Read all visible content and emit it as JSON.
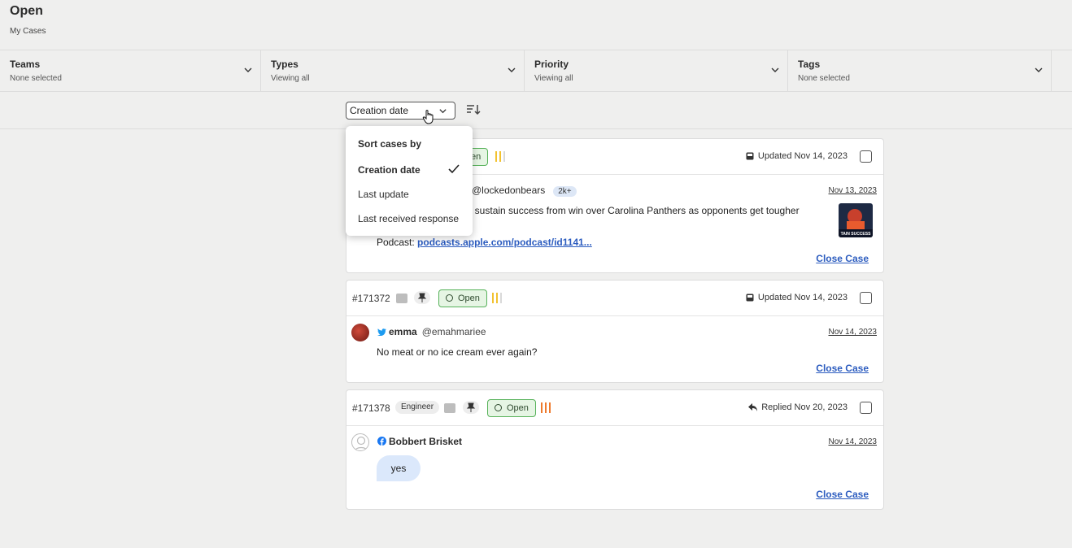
{
  "header": {
    "title": "Open",
    "subtitle": "My Cases"
  },
  "filters": [
    {
      "label": "Teams",
      "value": "None selected"
    },
    {
      "label": "Types",
      "value": "Viewing all"
    },
    {
      "label": "Priority",
      "value": "Viewing all"
    },
    {
      "label": "Tags",
      "value": "None selected"
    }
  ],
  "sort": {
    "selected": "Creation date",
    "menu_title": "Sort cases by",
    "options": [
      "Creation date",
      "Last update",
      "Last received response"
    ]
  },
  "cases": [
    {
      "status": "Open",
      "status_partial": "en",
      "updated": "Updated Nov 14, 2023",
      "handle": "@lockedonbears",
      "followers_badge": "2k+",
      "date": "Nov 13, 2023",
      "text": "an sustain success from win over Carolina Panthers as opponents get tougher",
      "podcast_label": "Podcast:",
      "podcast_link": "podcasts.apple.com/podcast/id1141...",
      "thumb_caption": "TAIN SUCCESS",
      "close_label": "Close Case",
      "priority_colors": [
        "#f2c230",
        "#f2c230",
        "#d9d9d9"
      ]
    },
    {
      "id": "#171372",
      "status": "Open",
      "updated": "Updated Nov 14, 2023",
      "name": "emma",
      "handle": "@emahmariee",
      "date": "Nov 14, 2023",
      "text": "No meat or no ice cream ever again?",
      "close_label": "Close Case",
      "priority_colors": [
        "#f2c230",
        "#f2c230",
        "#d9d9d9"
      ]
    },
    {
      "id": "#171378",
      "tag": "Engineer",
      "status": "Open",
      "updated": "Replied Nov 20, 2023",
      "name": "Bobbert Brisket",
      "date": "Nov 14, 2023",
      "text": "yes",
      "close_label": "Close Case",
      "priority_colors": [
        "#ee7a2d",
        "#ee7a2d",
        "#ee7a2d"
      ]
    }
  ],
  "colors": {
    "accent_link": "#2c5cbf",
    "open_green": "#57b25a",
    "twitter_blue": "#1d9bf0",
    "facebook_blue": "#1877f2"
  },
  "icons": [
    "chevron-down-icon",
    "sort-order-icon",
    "hand-cursor-icon",
    "check-icon",
    "chat-icon",
    "pin-icon",
    "inbox-icon",
    "reply-icon",
    "twitter-icon",
    "facebook-icon"
  ]
}
